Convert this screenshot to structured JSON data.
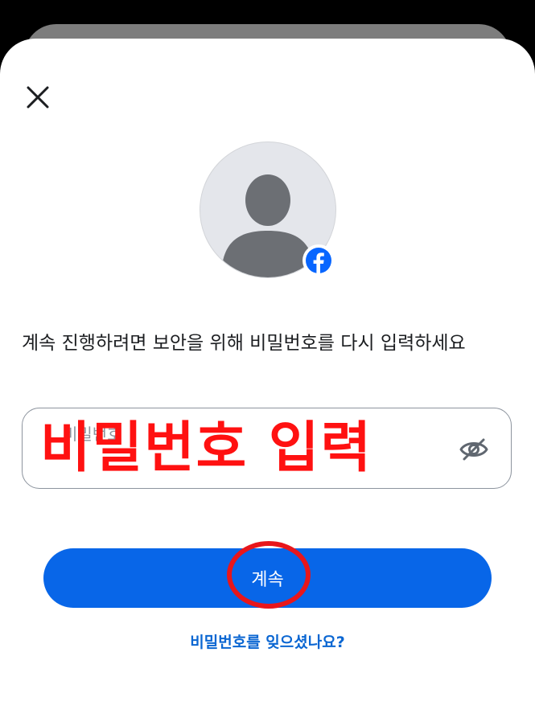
{
  "sheet": {
    "close_icon": "close-icon",
    "avatar_icon": "default-avatar-icon",
    "badge_icon": "facebook-icon",
    "prompt": "계속 진행하려면 보안을 위해 비밀번호를 다시 입력하세요",
    "password": {
      "placeholder": "비밀번호",
      "annotation": "비밀번호 입력",
      "toggle_icon": "eye-off-icon"
    },
    "continue_label": "계속",
    "forgot_label": "비밀번호를 잊으셨나요?"
  },
  "colors": {
    "primary": "#0866e8",
    "link": "#0a66d2",
    "annotation": "#ff1111"
  }
}
